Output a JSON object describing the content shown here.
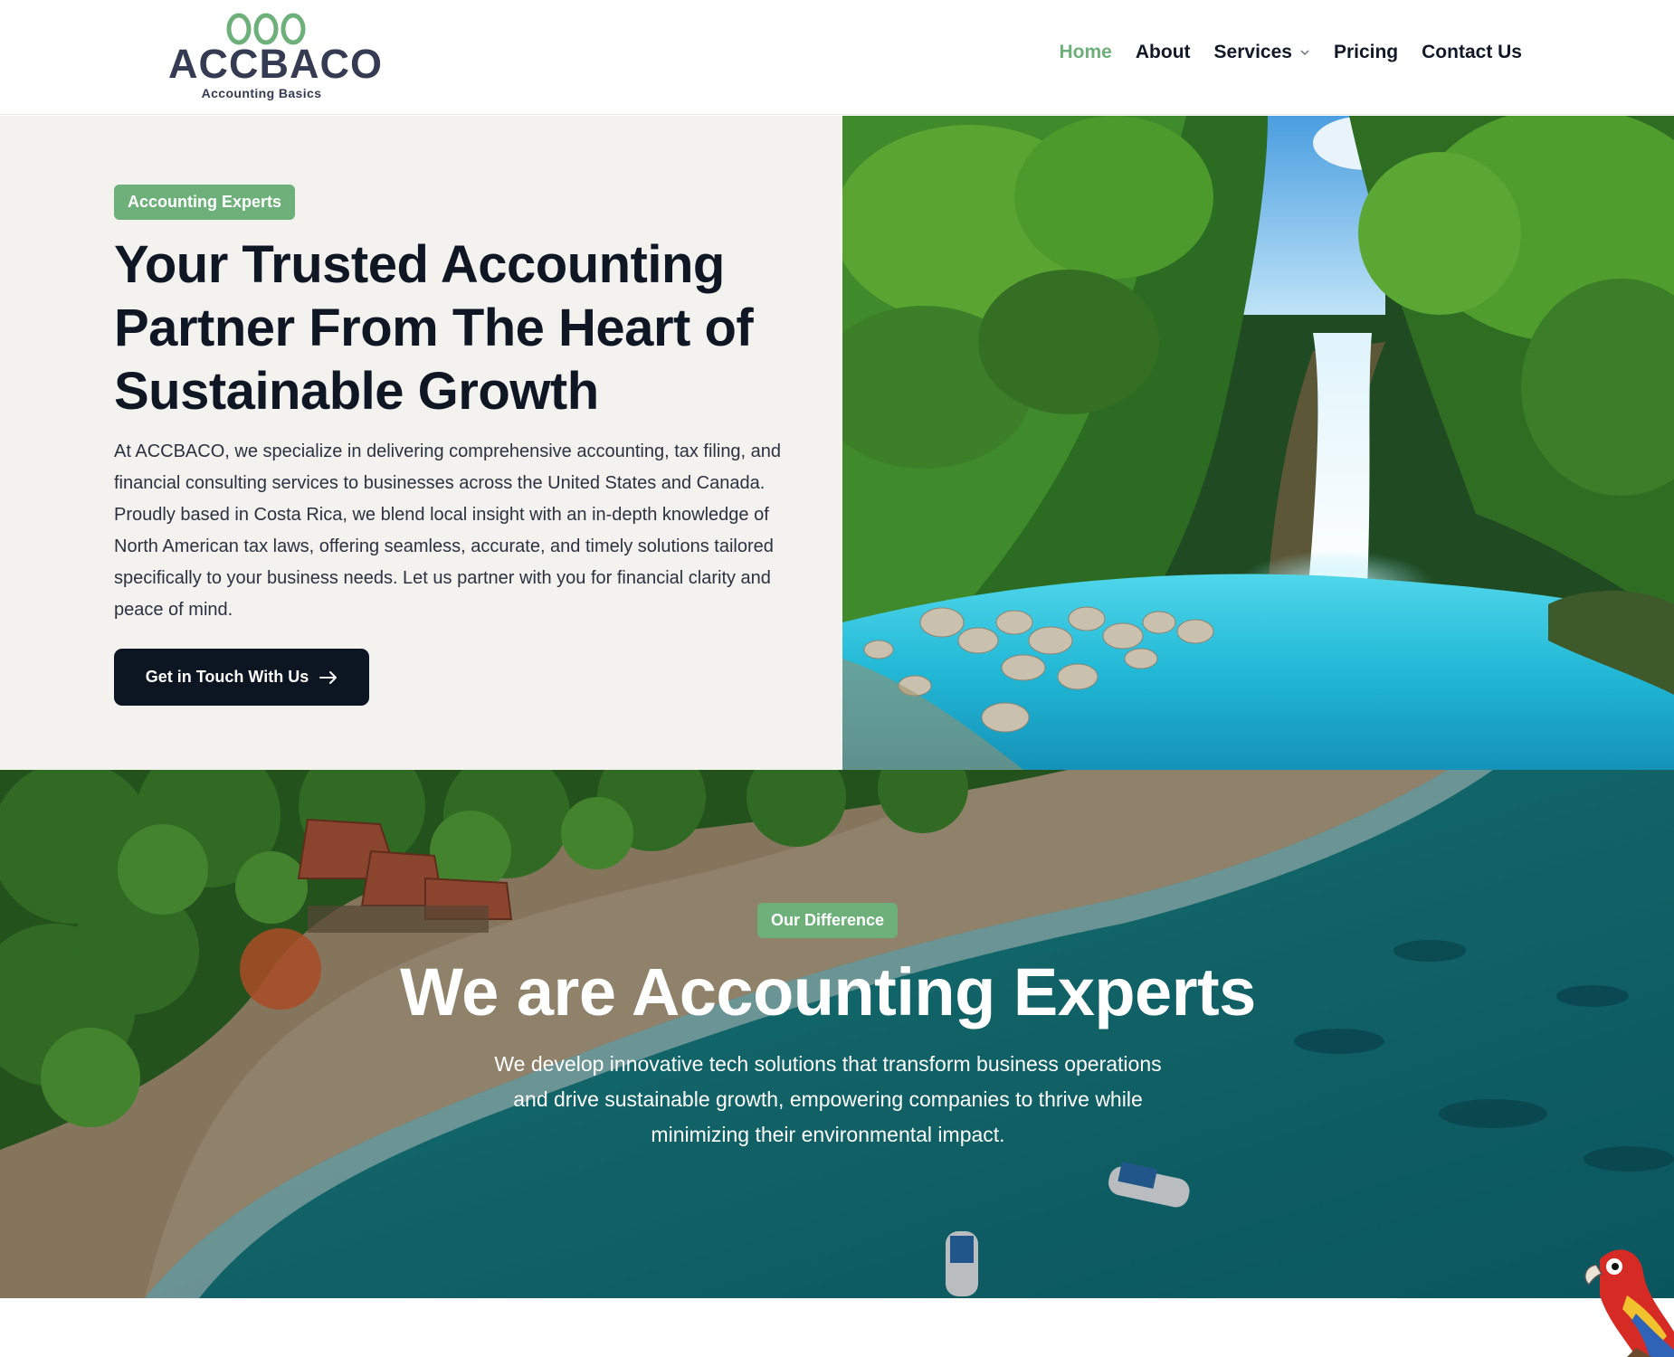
{
  "brand": {
    "name": "ACCBACO",
    "tagline": "Accounting Basics",
    "accent_color": "#6db07a",
    "dark_color": "#0c1522"
  },
  "nav": {
    "items": [
      {
        "label": "Home",
        "active": true
      },
      {
        "label": "About",
        "active": false
      },
      {
        "label": "Services",
        "active": false,
        "dropdown": true
      },
      {
        "label": "Pricing",
        "active": false
      },
      {
        "label": "Contact Us",
        "active": false
      }
    ]
  },
  "hero": {
    "badge": "Accounting Experts",
    "title": "Your Trusted Accounting Partner From The Heart of Sustainable Growth",
    "text": "At ACCBACO, we specialize in delivering comprehensive accounting, tax filing, and financial consulting services to businesses across the United States and Canada. Proudly based in Costa Rica, we blend local insight with an in-depth knowledge of North American tax laws, offering seamless, accurate, and timely solutions tailored specifically to your business needs. Let us partner with you for financial clarity and peace of mind.",
    "cta_label": "Get in Touch With Us",
    "cta_icon": "arrow-right-icon",
    "image": "waterfall-image"
  },
  "difference": {
    "badge": "Our Difference",
    "title": "We are Accounting Experts",
    "text": "We develop innovative tech solutions that transform business operations and drive sustainable growth, empowering companies to thrive while minimizing their environmental impact.",
    "image": "aerial-beach-image"
  },
  "decor": {
    "corner_icon": "parrot-icon"
  }
}
